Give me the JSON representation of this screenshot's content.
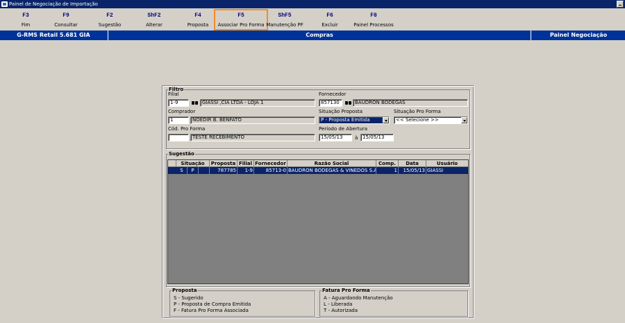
{
  "window": {
    "title": "Painel de Negociação de Importação"
  },
  "toolbar": {
    "buttons": [
      {
        "key": "F3",
        "label": "Fim"
      },
      {
        "key": "F9",
        "label": "Consultar"
      },
      {
        "key": "F2",
        "label": "Sugestão"
      },
      {
        "key": "ShF2",
        "label": "Alterar"
      },
      {
        "key": "F4",
        "label": "Proposta"
      },
      {
        "key": "F5",
        "label": "Associar Pro Forma"
      },
      {
        "key": "ShF5",
        "label": "Manutenção PF"
      },
      {
        "key": "F6",
        "label": "Excluir"
      },
      {
        "key": "F8",
        "label": "Painel Processos"
      }
    ],
    "highlight_color": "#f28c28"
  },
  "header": {
    "left": "G-RMS Retail 5.681 GIA",
    "center": "Compras",
    "right": "Painel Negociação"
  },
  "filtro": {
    "legend": "Filtro",
    "filial_label": "Filial",
    "filial_code": "1-9",
    "filial_name": "GIASSI ,CIA LTDA - LOJA 1",
    "fornecedor_label": "Fornecedor",
    "fornecedor_code": "857130",
    "fornecedor_name": "BAUDRON BODEGAS",
    "comprador_label": "Comprador",
    "comprador_code": "1",
    "comprador_name": "NOEDIR B. BENFATO",
    "situacao_proposta_label": "Situação Proposta",
    "situacao_proposta_value": "P - Proposta Emitida",
    "situacao_pro_forma_label": "Situação Pro Forma",
    "situacao_pro_forma_value": "<< Selecione >>",
    "cod_pro_forma_label": "Cód. Pro Forma",
    "cod_pro_forma_code": "",
    "cod_pro_forma_desc": "TESTE RECEBIMENTO",
    "periodo_label": "Período de Abertura",
    "periodo_from": "15/05/13",
    "periodo_sep": "à",
    "periodo_to": "15/05/13"
  },
  "sugestao": {
    "legend": "Sugestão",
    "columns": [
      "Situação",
      "Proposta",
      "Filial",
      "Fornecedor",
      "Razão Social",
      "Comp.",
      "Data",
      "Usuário"
    ],
    "rows": [
      {
        "sit1": "S",
        "sit2": "P",
        "sit3": "",
        "proposta": "787785",
        "filial": "1-9",
        "fornecedor": "85713-0",
        "razao": "BAUDRON BODEGAS & VINEDOS S.A",
        "comp": "1",
        "data": "15/05/13",
        "usuario": "GIASSI"
      }
    ]
  },
  "legend_proposta": {
    "title": "Proposta",
    "items": [
      "S - Sugerido",
      "P - Proposta de Compra Emitida",
      "F - Fatura Pro Forma Associada"
    ]
  },
  "legend_fatura": {
    "title": "Fatura Pro Forma",
    "items": [
      "A - Aguardando Manutenção",
      "L - Liberada",
      "T - Autorizada"
    ]
  }
}
